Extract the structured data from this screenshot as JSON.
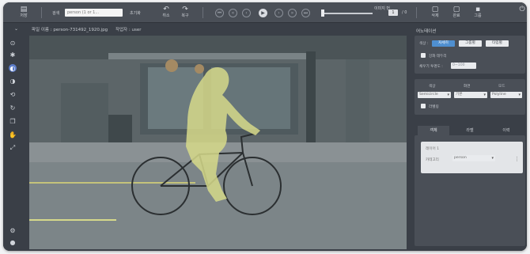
{
  "toolbar": {
    "save_label": "저장",
    "search_label": "검색",
    "search_value": "person (1 or 1...",
    "search_go_label": "초기화",
    "undo_label": "취소",
    "redo_label": "복구",
    "page_label": "이미지 번",
    "page_current": "1",
    "page_total": "/ 0",
    "btn_delete_label": "삭제",
    "btn_done_label": "완료",
    "btn_exit_label": "그룹"
  },
  "file_info": {
    "filename": "파일 이름 : person-731492_1920.jpg",
    "worker": "작업자 : user"
  },
  "annotation_panel": {
    "title": "어노테이션",
    "mode_label": "색상 :",
    "mode_buttons": [
      "자세히",
      "그룹별",
      "타입별"
    ],
    "show_label": "강화 테두리",
    "opacity_label": "채우기 투명도 :",
    "opacity_value": "0~100",
    "filter_headers": [
      "색상",
      "화면",
      "모드"
    ],
    "filter_values": [
      "Semicircle",
      "기본",
      "Polyline"
    ],
    "filter_check_label": "라벨링"
  },
  "tabs": [
    "객체",
    "라벨",
    "이력"
  ],
  "layer": {
    "label": "레이어 1",
    "class_label": "카테고리",
    "class_value": "person"
  },
  "colors": {
    "accent": "#4f8fd0",
    "mask": "#d6d98a",
    "panel": "#3a3f47"
  }
}
